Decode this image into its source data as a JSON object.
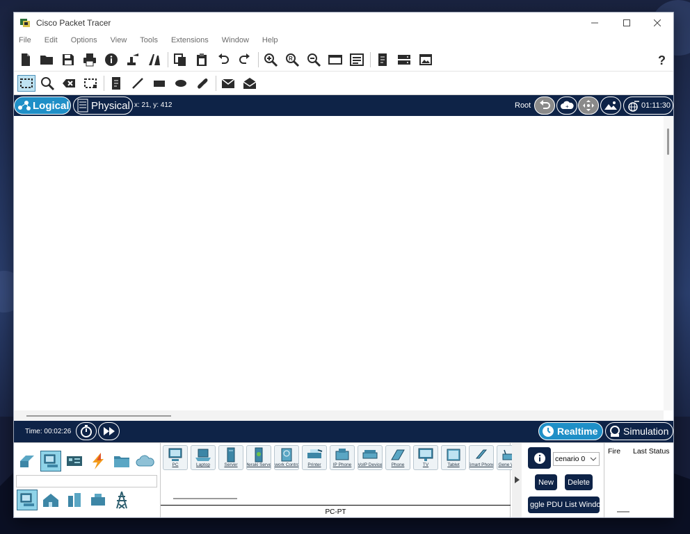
{
  "window": {
    "title": "Cisco Packet Tracer"
  },
  "menu": [
    "File",
    "Edit",
    "Options",
    "View",
    "Tools",
    "Extensions",
    "Window",
    "Help"
  ],
  "toolbar_main": [
    "new-file-icon",
    "open-folder-icon",
    "save-icon",
    "print-icon",
    "info-icon",
    "activity-wizard-icon",
    "custom-device-icon",
    "copy-icon",
    "paste-icon",
    "undo-icon",
    "redo-icon",
    "zoom-in-icon",
    "zoom-reset-icon",
    "zoom-out-icon",
    "drawing-palette-icon",
    "custom-devices-dialog-icon",
    "note-icon",
    "device-template-icon",
    "image-icon",
    "help-icon"
  ],
  "toolbar_tools": [
    "select-icon",
    "inspect-icon",
    "delete-icon",
    "resize-shape-icon",
    "note-tool-icon",
    "line-tool-icon",
    "rectangle-tool-icon",
    "ellipse-tool-icon",
    "freeform-tool-icon",
    "add-simple-pdu-icon",
    "add-complex-pdu-icon"
  ],
  "nav": {
    "logical_label": "Logical",
    "physical_label": "Physical",
    "coords": "x: 21, y: 412",
    "root_label": "Root",
    "clock": "01:11:30"
  },
  "timebar": {
    "time_label": "Time: 00:02:26",
    "realtime_label": "Realtime",
    "simulation_label": "Simulation"
  },
  "devices": [
    {
      "label": "PC",
      "icon": "pc-icon"
    },
    {
      "label": "Laptop",
      "icon": "laptop-icon"
    },
    {
      "label": "Server",
      "icon": "server-icon"
    },
    {
      "label": "Meraki Server",
      "icon": "meraki-server-icon"
    },
    {
      "label": "Network Controller",
      "icon": "network-controller-icon"
    },
    {
      "label": "Printer",
      "icon": "printer-icon"
    },
    {
      "label": "IP Phone",
      "icon": "ip-phone-icon"
    },
    {
      "label": "VoIP Device",
      "icon": "voip-device-icon"
    },
    {
      "label": "Phone",
      "icon": "phone-icon"
    },
    {
      "label": "TV",
      "icon": "tv-icon"
    },
    {
      "label": "Tablet",
      "icon": "tablet-icon"
    },
    {
      "label": "Smart Phone",
      "icon": "smart-phone-icon"
    },
    {
      "label": "Gene Wire",
      "icon": "generic-wireless-icon"
    }
  ],
  "selected_device_name": "PC-PT",
  "scenario": {
    "select_value": "cenario 0",
    "new_label": "New",
    "delete_label": "Delete",
    "toggle_label": "ggle PDU List Windo"
  },
  "pdu_table": {
    "columns": [
      "Fire",
      "Last Status"
    ]
  },
  "colors": {
    "navy": "#0e2347",
    "accent": "#1f8fc7",
    "selected": "#8fd3e8"
  }
}
